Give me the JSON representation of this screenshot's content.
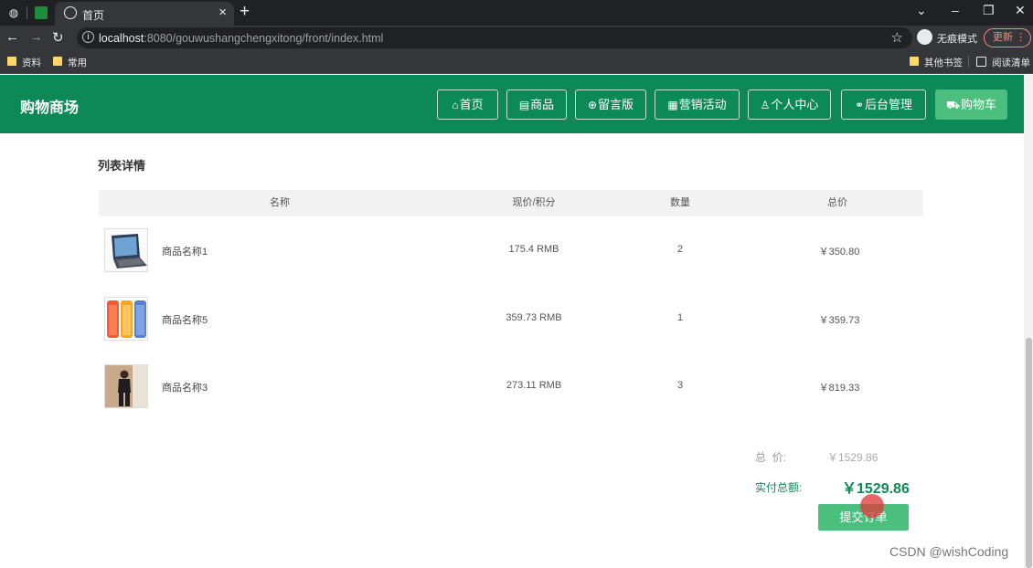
{
  "browser": {
    "tab_title": "首页",
    "tab_close": "×",
    "new_tab": "+",
    "url_host": "localhost",
    "url_path": ":8080/gouwushangchengxitong/front/index.html",
    "incognito_label": "无痕模式",
    "update_label": "更新",
    "update_menu": "⋮",
    "bookmarks": [
      "资料",
      "常用"
    ],
    "bookmarks_right": [
      "其他书签",
      "阅读清单"
    ],
    "window_controls": [
      "⌄",
      "–",
      "❐",
      "✕"
    ]
  },
  "header": {
    "brand": "购物商场",
    "nav": [
      {
        "icon": "⌂",
        "label": "首页"
      },
      {
        "icon": "▤",
        "label": "商品"
      },
      {
        "icon": "⊕",
        "label": "留言版"
      },
      {
        "icon": "▦",
        "label": "营销活动"
      },
      {
        "icon": "♙",
        "label": "个人中心"
      },
      {
        "icon": "⚭",
        "label": "后台管理"
      },
      {
        "icon": "⛟",
        "label": "购物车"
      }
    ]
  },
  "cart": {
    "title": "列表详情",
    "columns": [
      "名称",
      "现价/积分",
      "数量",
      "总价"
    ],
    "items": [
      {
        "name": "商品名称1",
        "price": "175.4 RMB",
        "qty": "2",
        "total": "￥350.80",
        "image": "laptop"
      },
      {
        "name": "商品名称5",
        "price": "359.73 RMB",
        "qty": "1",
        "total": "￥359.73",
        "image": "phones"
      },
      {
        "name": "商品名称3",
        "price": "273.11 RMB",
        "qty": "3",
        "total": "￥819.33",
        "image": "person"
      }
    ],
    "total_label": "总  价:",
    "total_value": "￥1529.86",
    "pay_label": "实付总额:",
    "pay_value": "￥1529.86",
    "submit_label": "提交订单"
  },
  "watermark": "CSDN @wishCoding",
  "colors": {
    "primary": "#0d8957",
    "accent": "#4cbf7e"
  }
}
